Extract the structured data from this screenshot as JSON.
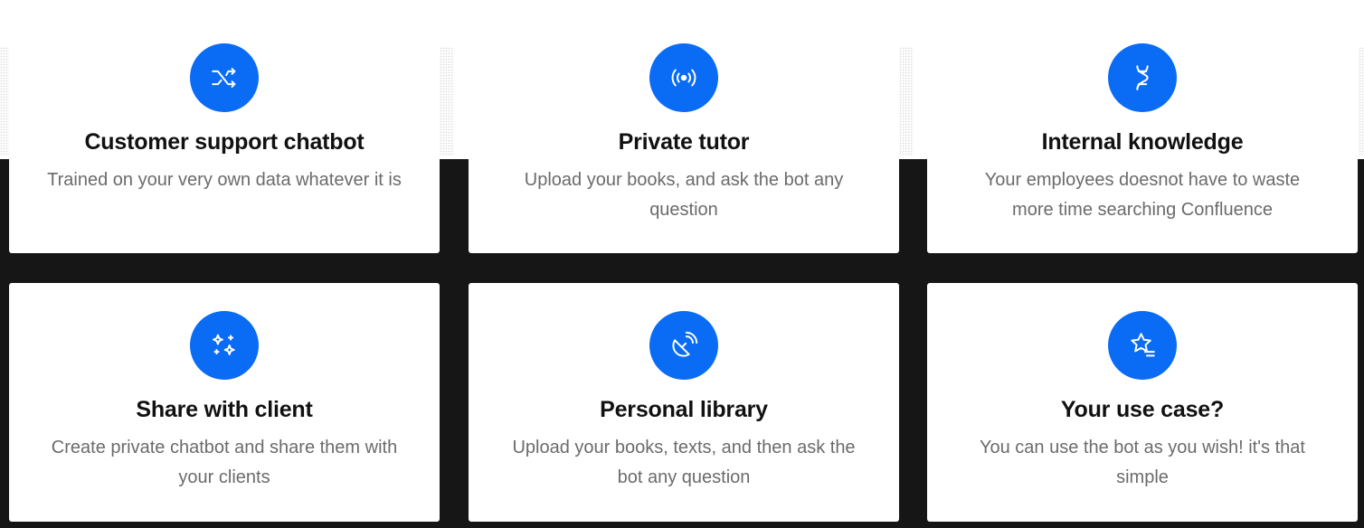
{
  "cards": [
    {
      "icon": "shuffle-icon",
      "title": "Customer support chatbot",
      "description": "Trained on your very own data whatever it is"
    },
    {
      "icon": "broadcast-icon",
      "title": "Private tutor",
      "description": "Upload your books, and ask the bot any question"
    },
    {
      "icon": "dna-icon",
      "title": "Internal knowledge",
      "description": "Your employees doesnot have to waste more time searching Confluence"
    },
    {
      "icon": "sparkles-icon",
      "title": "Share with client",
      "description": "Create private chatbot and share them with your clients"
    },
    {
      "icon": "satellite-dish-icon",
      "title": "Personal library",
      "description": "Upload your books, texts, and then ask the bot any question"
    },
    {
      "icon": "star-list-icon",
      "title": "Your use case?",
      "description": "You can use the bot as you wish! it's that simple"
    }
  ],
  "colors": {
    "accent": "#0a6cf5",
    "background": "#161616",
    "card": "#ffffff",
    "title": "#111111",
    "description": "#6b6b6b"
  }
}
